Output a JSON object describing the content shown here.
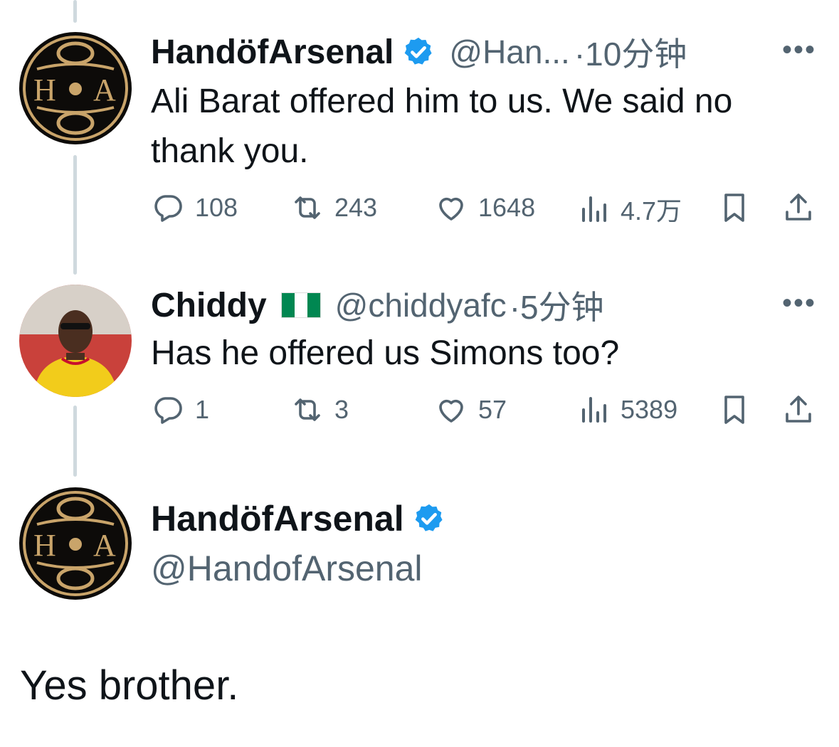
{
  "tweets": [
    {
      "name": "HandöfArsenal",
      "handle": "@Han...",
      "time": "·10分钟",
      "text": "Ali Barat offered him to us. We said no thank you.",
      "replies": "108",
      "retweets": "243",
      "likes": "1648",
      "views": "4.7万",
      "avatar_text": "H A"
    },
    {
      "name": "Chiddy",
      "handle": "@chiddyafc",
      "time": "·5分钟",
      "text": "Has he offered us Simons too?",
      "replies": "1",
      "retweets": "3",
      "likes": "57",
      "views": "5389"
    }
  ],
  "main_tweet": {
    "name": "HandöfArsenal",
    "handle": "@HandofArsenal",
    "text": "Yes brother.",
    "avatar_text": "H A"
  },
  "more_label": "•••",
  "colors": {
    "verified": "#1d9bf0",
    "secondary_text": "#536471",
    "thread_line": "#cfd9de",
    "hoa_gold": "#c9a46a",
    "flag_green": "#008751"
  }
}
